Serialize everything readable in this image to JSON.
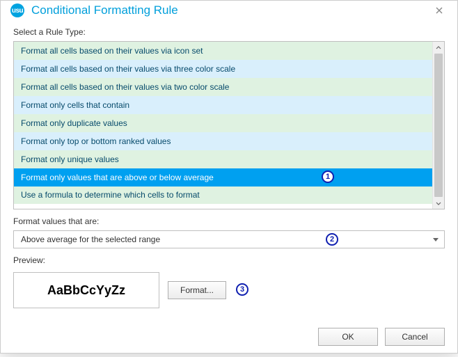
{
  "dialog": {
    "title": "Conditional Formatting Rule",
    "app_icon_text": "usu"
  },
  "labels": {
    "select_rule_type": "Select a Rule Type:",
    "format_values_that_are": "Format values that are:",
    "preview": "Preview:"
  },
  "rule_types": [
    "Format all cells based on their values via icon set",
    "Format all cells based on their values via three color scale",
    "Format all cells based on their values via two color scale",
    "Format only cells that contain",
    "Format only duplicate values",
    "Format only top or bottom ranked values",
    "Format only unique values",
    "Format only values that are above or below average",
    "Use a formula to determine which cells to format"
  ],
  "selected_rule_index": 7,
  "criteria": {
    "selected": "Above average for the selected range"
  },
  "preview": {
    "sample_text": "AaBbCcYyZz"
  },
  "buttons": {
    "format": "Format...",
    "ok": "OK",
    "cancel": "Cancel"
  },
  "callouts": {
    "one": "1",
    "two": "2",
    "three": "3"
  }
}
